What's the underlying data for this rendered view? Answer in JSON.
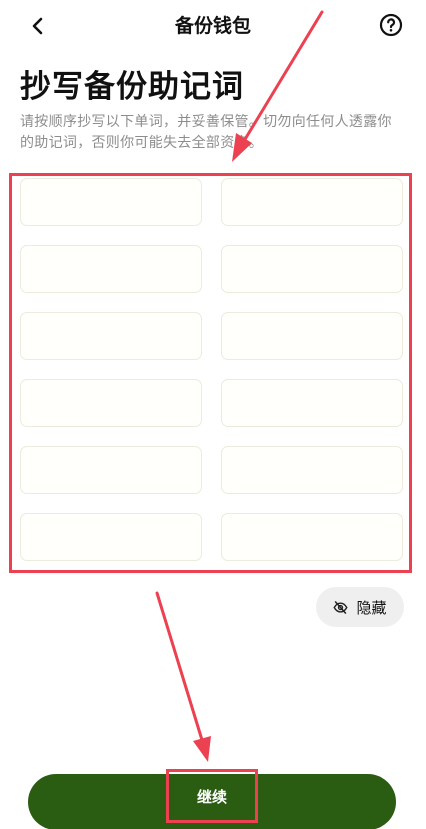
{
  "header": {
    "title": "备份钱包",
    "back_icon": "chevron-left-icon",
    "help_icon": "question-circle-icon"
  },
  "page": {
    "title": "抄写备份助记词",
    "subtitle": "请按顺序抄写以下单词，并妥善保管。切勿向任何人透露你的助记词，否则你可能失去全部资产。"
  },
  "mnemonic": {
    "words": [
      "",
      "",
      "",
      "",
      "",
      "",
      "",
      "",
      "",
      "",
      "",
      ""
    ]
  },
  "hide_button": {
    "label": "隐藏",
    "icon": "eye-off-icon"
  },
  "continue_button": {
    "label": "继续"
  },
  "colors": {
    "primary": "#2a5d12",
    "annotation": "#ec4150",
    "cell_background": "#fffffb",
    "cell_border": "#ecebdd",
    "subtitle": "#8d8d8d"
  }
}
